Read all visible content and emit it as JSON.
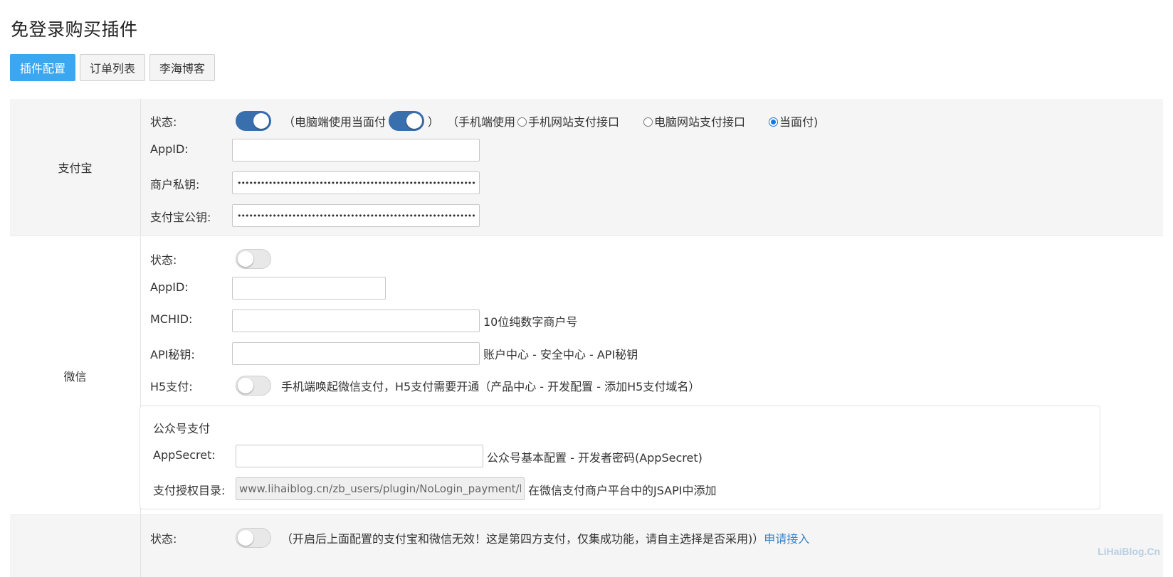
{
  "page": {
    "title": "免登录购买插件"
  },
  "tabs": [
    {
      "label": "插件配置",
      "active": true
    },
    {
      "label": "订单列表",
      "active": false
    },
    {
      "label": "李海博客",
      "active": false
    }
  ],
  "alipay": {
    "section_label": "支付宝",
    "status_label": "状态:",
    "status_on": true,
    "pc_facepay_text": "（电脑端使用当面付",
    "pc_facepay_on": true,
    "close_paren": "）",
    "mobile_prefix": "（手机端使用",
    "radio_options": [
      {
        "label": "手机网站支付接口",
        "checked": false
      },
      {
        "label": "电脑网站支付接口",
        "checked": false
      },
      {
        "label": "当面付)",
        "checked": true
      }
    ],
    "appid_label": "AppID:",
    "appid_value": "",
    "private_key_label": "商户私钥:",
    "private_key_mask": "••••••••••••••••••••••••••••••••••••••••••••••••••••••••••••••••••••",
    "public_key_label": "支付宝公钥:",
    "public_key_mask": "••••••••••••••••••••••••••••••••••••••••••••••••••••••••••••••••••••"
  },
  "wechat": {
    "section_label": "微信",
    "status_label": "状态:",
    "status_on": false,
    "appid_label": "AppID:",
    "appid_value": "",
    "mchid_label": "MCHID:",
    "mchid_value": "",
    "mchid_hint": "10位纯数字商户号",
    "apikey_label": "API秘钥:",
    "apikey_value": "",
    "apikey_hint": "账户中心 - 安全中心 - API秘钥",
    "h5_label": "H5支付:",
    "h5_on": false,
    "h5_hint": "手机端唤起微信支付，H5支付需要开通（产品中心 - 开发配置 - 添加H5支付域名）",
    "mp": {
      "title": "公众号支付",
      "appsecret_label": "AppSecret:",
      "appsecret_value": "",
      "appsecret_hint": "公众号基本配置 - 开发者密码(AppSecret)",
      "authdir_label": "支付授权目录:",
      "authdir_value": "www.lihaiblog.cn/zb_users/plugin/NoLogin_payment/lib",
      "authdir_hint": "在微信支付商户平台中的JSAPI中添加"
    }
  },
  "fourth": {
    "status_label": "状态:",
    "status_on": false,
    "note": "（开启后上面配置的支付宝和微信无效！这是第四方支付，仅集成功能，请自主选择是否采用)）",
    "link_text": "申请接入"
  },
  "watermark": "LiHaiBlog.Cn",
  "colors": {
    "accent": "#3aa7f0",
    "toggle_on": "#3a6fae",
    "link": "#3a86c8"
  }
}
